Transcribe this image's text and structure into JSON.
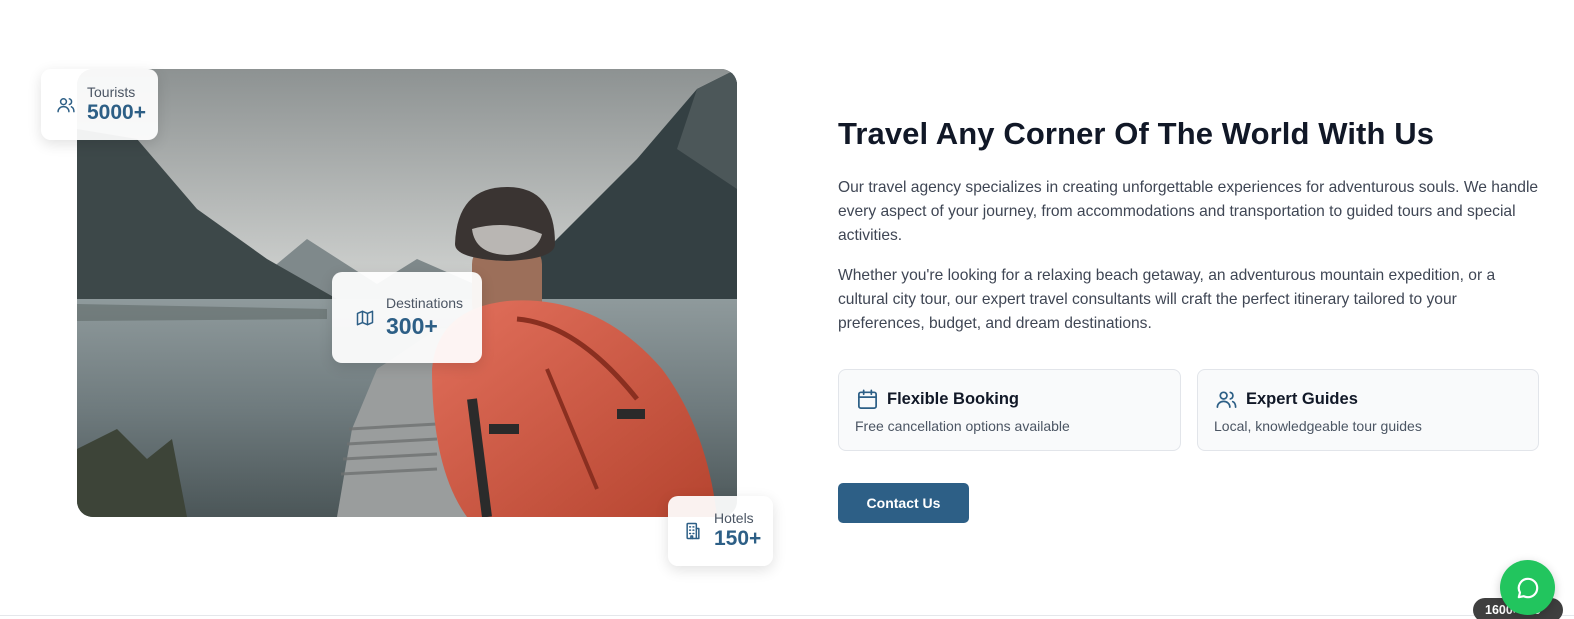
{
  "stats": {
    "tourists": {
      "label": "Tourists",
      "value": "5000+",
      "icon": "users-icon"
    },
    "destinations": {
      "label": "Destinations",
      "value": "300+",
      "icon": "map-icon"
    },
    "hotels": {
      "label": "Hotels",
      "value": "150+",
      "icon": "building-icon"
    }
  },
  "hero": {
    "image": "backpacker-at-mountain-lake-photo"
  },
  "content": {
    "heading": "Travel Any Corner Of The World With Us",
    "paragraph_1": "Our travel agency specializes in creating unforgettable experiences for adventurous souls. We handle every aspect of your journey, from accommodations and transportation to guided tours and special activities.",
    "paragraph_2": "Whether you're looking for a relaxing beach getaway, an adventurous mountain expedition, or a cultural city tour, our expert travel consultants will craft the perfect itinerary tailored to your preferences, budget, and dream destinations.",
    "features": [
      {
        "title": "Flexible Booking",
        "description": "Free cancellation options available",
        "icon": "calendar-icon"
      },
      {
        "title": "Expert Guides",
        "description": "Local, knowledgeable tour guides",
        "icon": "users-icon"
      }
    ],
    "contact_button": "Contact Us"
  },
  "widgets": {
    "chat_icon": "chat-bubble-icon",
    "dimension_badge": "1600×749"
  },
  "colors": {
    "accent": "#2d5f86",
    "chat": "#22c55e",
    "heading": "#111827"
  }
}
